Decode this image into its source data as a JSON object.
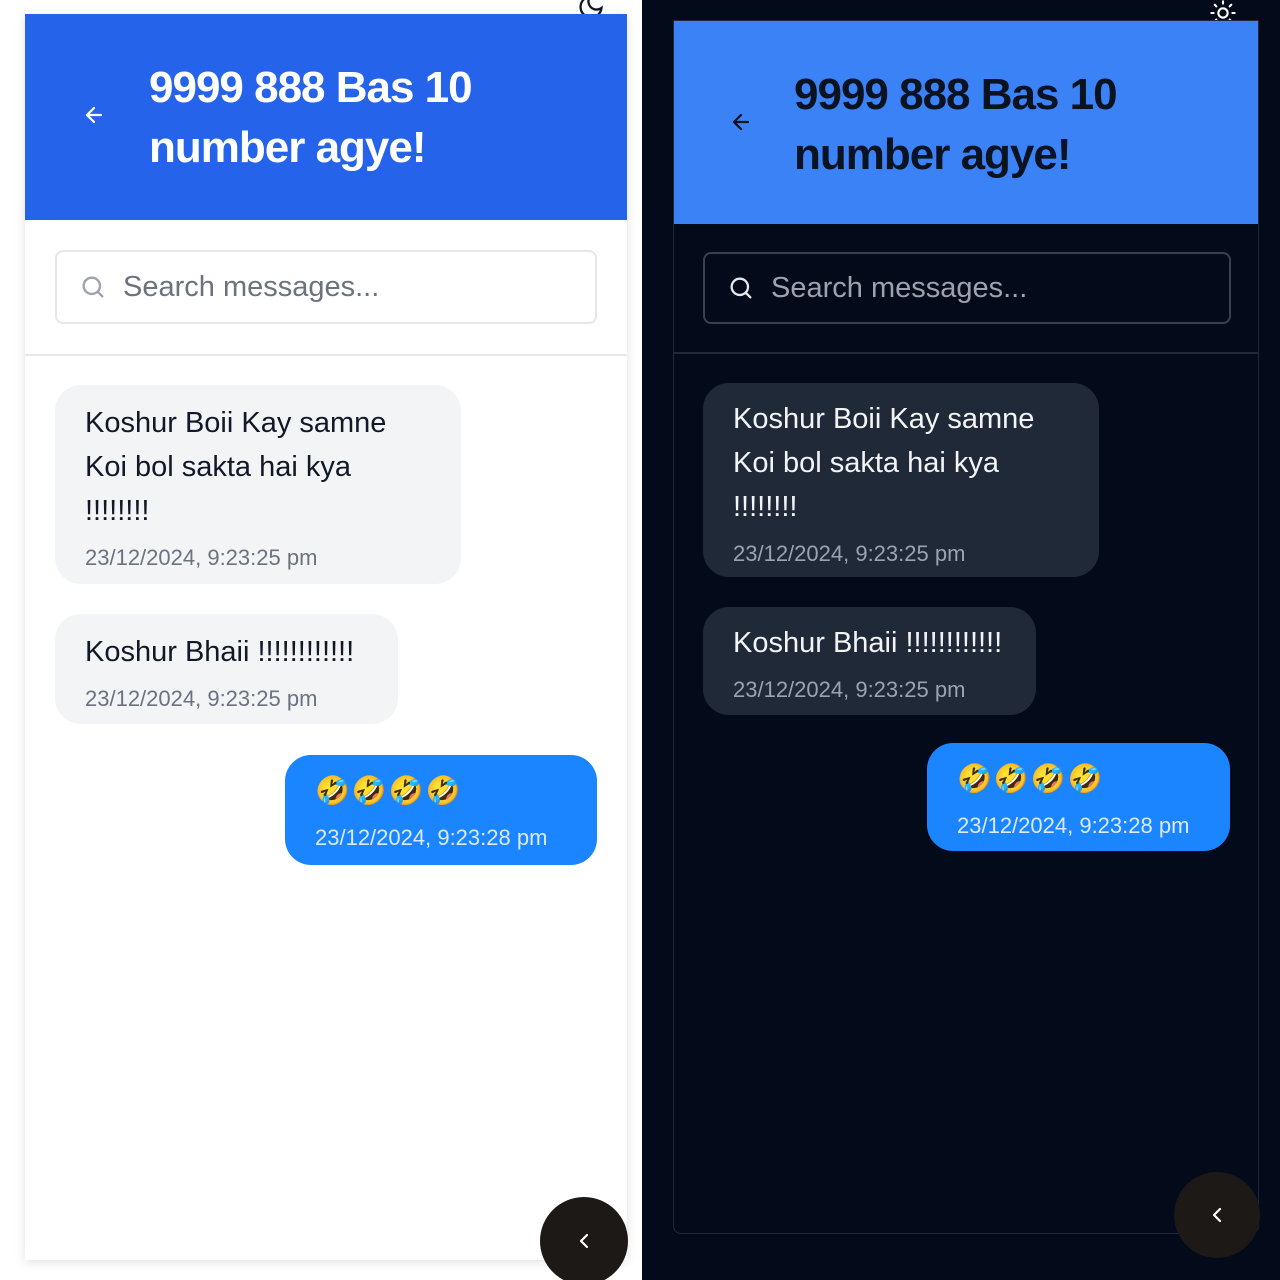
{
  "header": {
    "title": "9999 888 Bas 10 number agye!"
  },
  "search": {
    "placeholder": "Search messages..."
  },
  "messages": [
    {
      "direction": "received",
      "text": "Koshur Boii Kay samne\nKoi bol sakta hai kya\n!!!!!!!!",
      "timestamp": "23/12/2024, 9:23:25 pm"
    },
    {
      "direction": "received",
      "text": "Koshur Bhaii !!!!!!!!!!!!",
      "timestamp": "23/12/2024, 9:23:25 pm"
    },
    {
      "direction": "sent",
      "text": "🤣🤣🤣🤣",
      "timestamp": "23/12/2024, 9:23:28 pm"
    }
  ],
  "icons": {
    "back": "arrow-left-icon",
    "search": "search-icon",
    "scroll": "chevron-left-icon",
    "theme_light_mode": "moon-icon",
    "theme_dark_mode": "sun-icon"
  },
  "colors": {
    "header_light": "#2563eb",
    "header_dark": "#3b82f6",
    "sent_bubble": "#1a85ff",
    "dark_background": "#030a1a"
  }
}
